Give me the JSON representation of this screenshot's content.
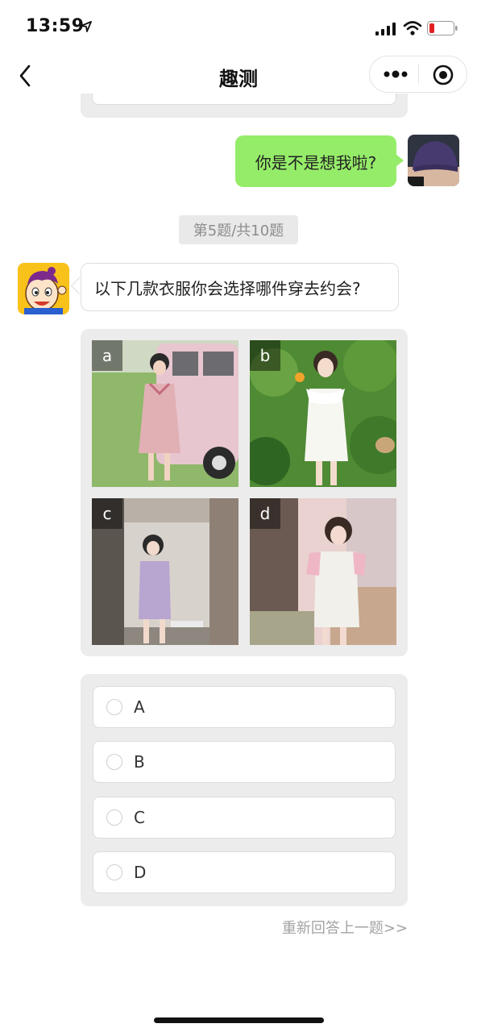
{
  "status_bar": {
    "time": "13:59",
    "icons": [
      "location-arrow-icon",
      "signal-icon",
      "wifi-icon",
      "battery-low-icon"
    ]
  },
  "nav": {
    "title": "趣测",
    "back_icon": "chevron-left-icon",
    "more_icon": "more-dots-icon",
    "close_icon": "target-icon"
  },
  "chat": {
    "user_message": "你是不是想我啦?",
    "progress": "第5题/共10题",
    "question": "以下几款衣服你会选择哪件穿去约会?"
  },
  "images": [
    {
      "label": "a"
    },
    {
      "label": "b"
    },
    {
      "label": "c"
    },
    {
      "label": "d"
    }
  ],
  "options": [
    {
      "label": "A"
    },
    {
      "label": "B"
    },
    {
      "label": "C"
    },
    {
      "label": "D"
    }
  ],
  "redo_link": "重新回答上一题>>",
  "colors": {
    "user_bubble": "#95ec69",
    "card_bg": "#ececec",
    "muted_text": "#a3a3a3"
  }
}
